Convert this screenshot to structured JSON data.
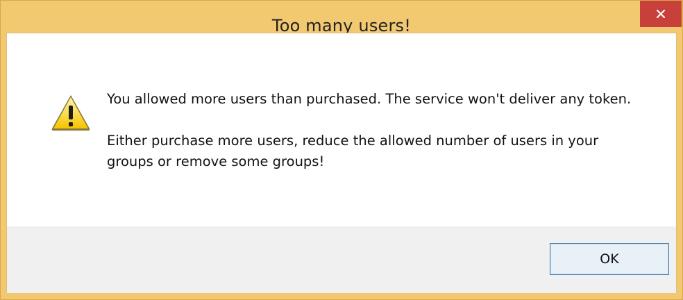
{
  "dialog": {
    "title": "Too many users!",
    "close_icon": "close-icon",
    "warning_icon": "warning-icon",
    "message_line1": "You allowed more users than purchased. The service won't deliver any token.",
    "message_line2": "Either purchase more users, reduce the allowed number of users in your groups or remove some groups!",
    "ok_label": "OK"
  },
  "colors": {
    "title_bar": "#f2c870",
    "close_button": "#c7403a",
    "footer": "#f0f0f0",
    "ok_border": "#3c7fb1"
  }
}
